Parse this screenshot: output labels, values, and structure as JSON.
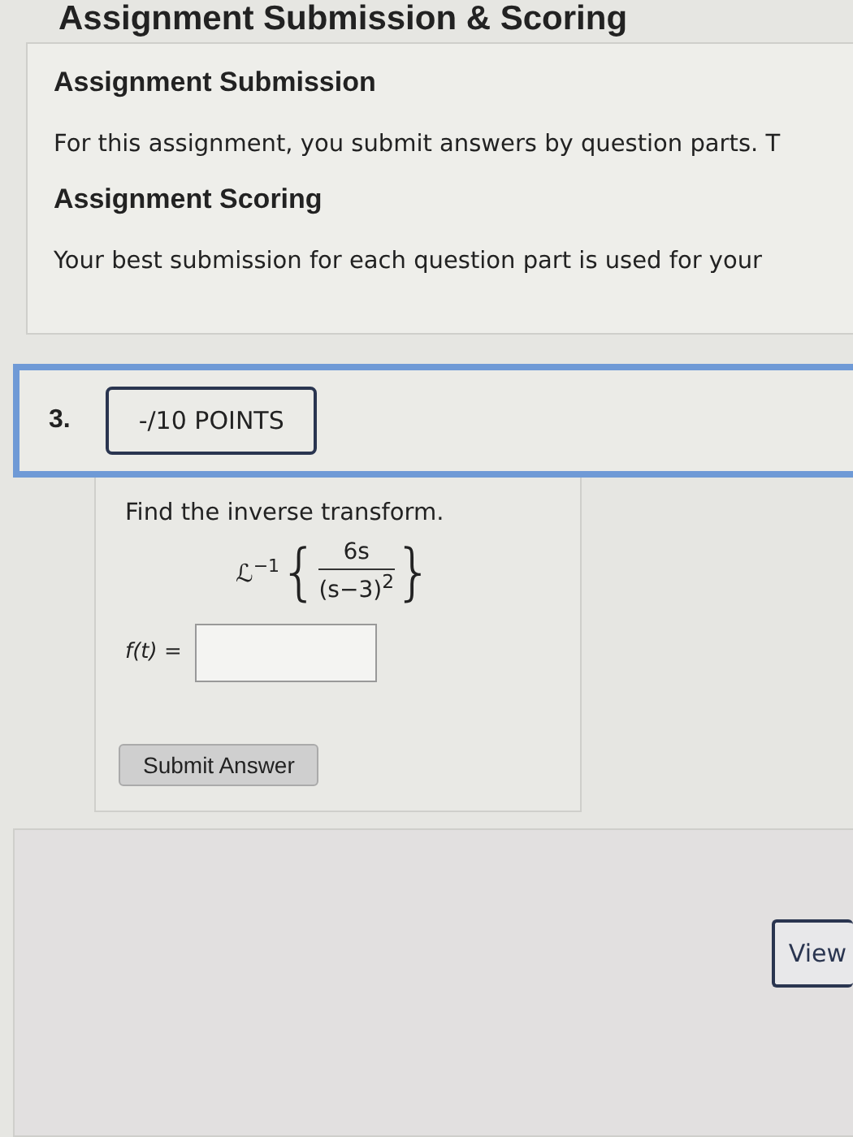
{
  "page_title": "Assignment Submission & Scoring",
  "info_sections": [
    {
      "heading": "Assignment Submission",
      "text": "For this assignment, you submit answers by question parts. T"
    },
    {
      "heading": "Assignment Scoring",
      "text": "Your best submission for each question part is used for your"
    }
  ],
  "question": {
    "number": "3.",
    "points": "-/10 POINTS",
    "prompt": "Find the inverse transform.",
    "math": {
      "operator": "ℒ",
      "superscript": "−1",
      "open": "{",
      "numerator": "6s",
      "denominator": "(s−3)$^{2}$",
      "close": "}"
    },
    "answer_label": "f(t) =",
    "submit_button": "Submit Answer"
  },
  "view_button": "View"
}
